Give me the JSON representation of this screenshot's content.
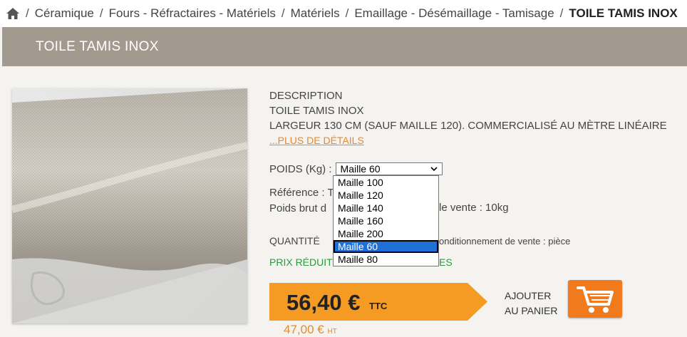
{
  "breadcrumb": {
    "items": [
      "Céramique",
      "Fours - Réfractaires - Matériels",
      "Matériels",
      "Emaillage - Désémaillage - Tamisage"
    ],
    "current": "TOILE TAMIS INOX",
    "separator": "/"
  },
  "banner": {
    "title": "TOILE TAMIS INOX"
  },
  "product": {
    "description_heading": "DESCRIPTION",
    "name": "TOILE TAMIS INOX",
    "description": "LARGEUR 130 CM (SAUF MAILLE 120). COMMERCIALISÉ AU MÈTRE LINÉAIRE",
    "more_link": "...PLUS DE DÉTAILS",
    "poids_label": "POIDS (Kg) :",
    "selected_option": "Maille 60",
    "options": [
      "Maille 100",
      "Maille 120",
      "Maille 140",
      "Maille 160",
      "Maille 200",
      "Maille 60",
      "Maille 80"
    ],
    "reference_label": "Référence : T",
    "poids_brut_label": "Poids brut d",
    "vente_text": "le vente : 10kg",
    "quantite_label": "QUANTITÉ",
    "conditionnement": "onditionnement de vente : pièce",
    "promo_left": "PRIX RÉDUIT",
    "promo_right": "ES"
  },
  "price": {
    "value": "56,40 €",
    "unit": "TTC",
    "old_value": "47,00 €",
    "old_unit": "HT"
  },
  "cart": {
    "label_line1": "AJOUTER",
    "label_line2": "AU PANIER"
  },
  "colors": {
    "banner": "#a39a8f",
    "accent": "#f59a23",
    "cart": "#f07a1c",
    "link": "#e8892a",
    "promo": "#2a9a3c"
  }
}
